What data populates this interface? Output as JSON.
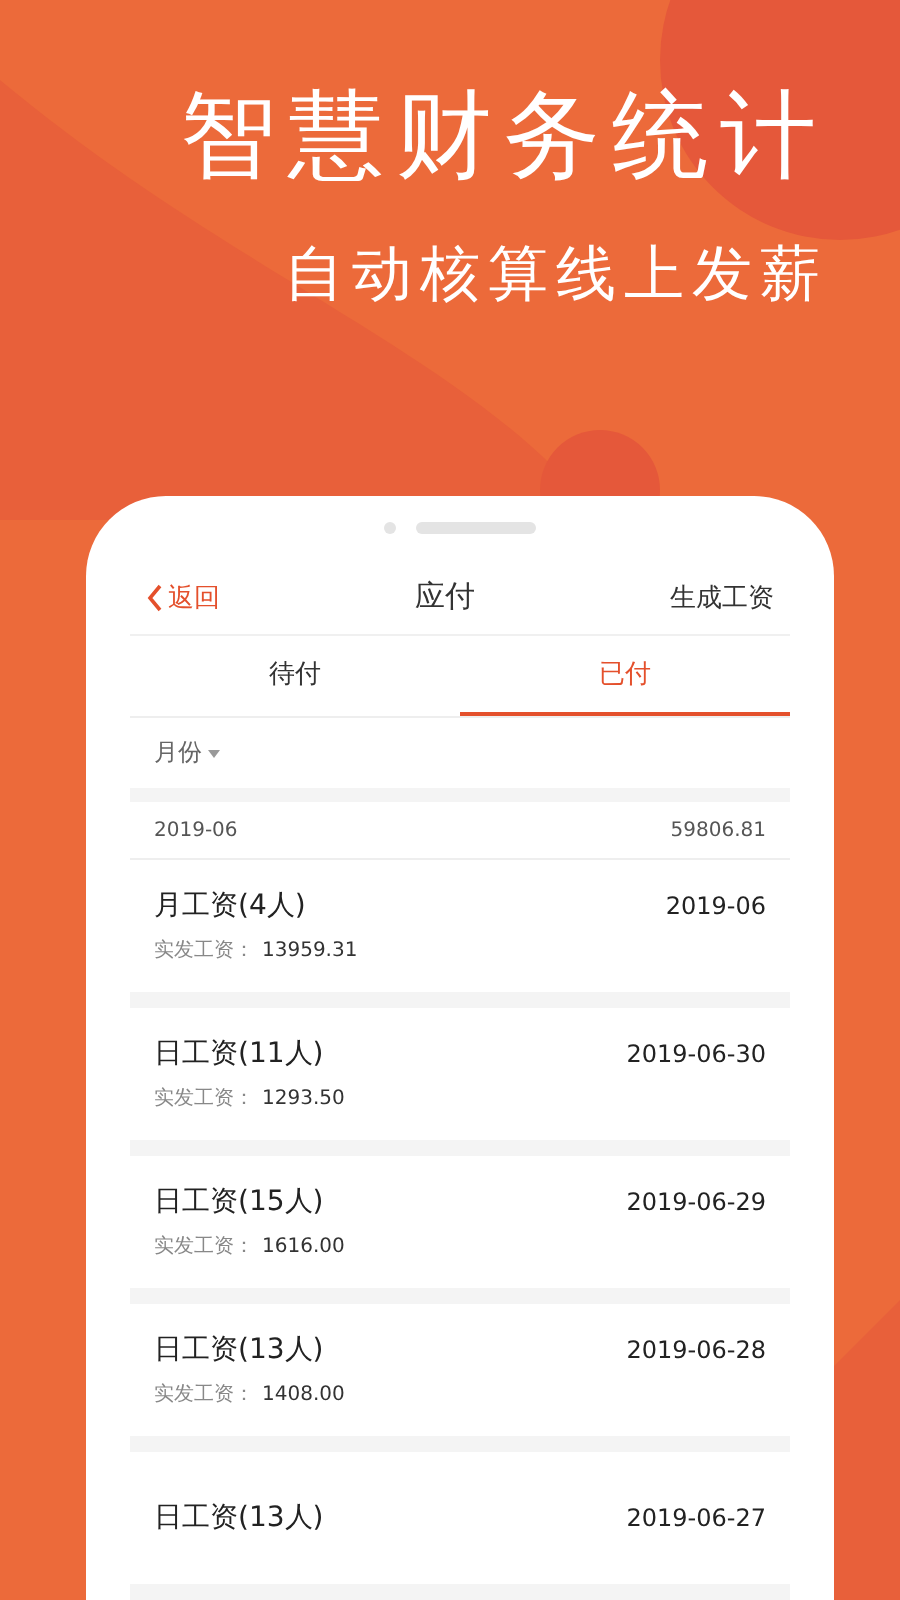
{
  "headline": "智慧财务统计",
  "subheadline": "自动核算线上发薪",
  "nav": {
    "back": "返回",
    "title": "应付",
    "action": "生成工资"
  },
  "tabs": [
    {
      "label": "待付",
      "selected": false
    },
    {
      "label": "已付",
      "selected": true
    }
  ],
  "filter": {
    "label": "月份"
  },
  "summary": {
    "period": "2019-06",
    "total": "59806.81"
  },
  "records": [
    {
      "title": "月工资(4人)",
      "date": "2019-06",
      "amount_label": "实发工资：",
      "amount": "13959.31"
    },
    {
      "title": "日工资(11人)",
      "date": "2019-06-30",
      "amount_label": "实发工资：",
      "amount": "1293.50"
    },
    {
      "title": "日工资(15人)",
      "date": "2019-06-29",
      "amount_label": "实发工资：",
      "amount": "1616.00"
    },
    {
      "title": "日工资(13人)",
      "date": "2019-06-28",
      "amount_label": "实发工资：",
      "amount": "1408.00"
    },
    {
      "title": "日工资(13人)",
      "date": "2019-06-27"
    }
  ]
}
